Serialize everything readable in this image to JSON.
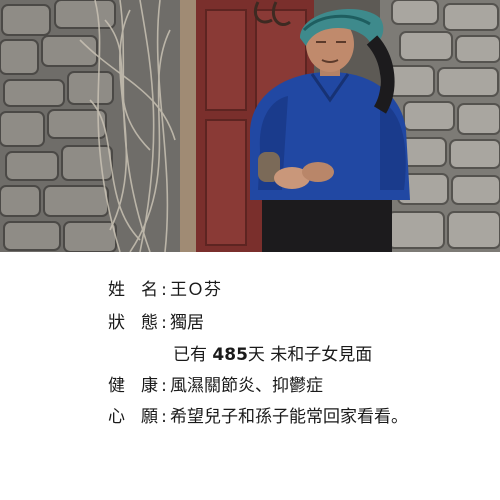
{
  "photo": {
    "subject": "elderly-woman-portrait-icon"
  },
  "profile": {
    "separator": ":",
    "name": {
      "label": "姓 名",
      "value": "王Ｏ芬"
    },
    "status": {
      "label": "狀 態",
      "value": "獨居",
      "note_prefix": "已有 ",
      "note_days": "485",
      "note_suffix": "天 未和子女見面"
    },
    "health": {
      "label": "健 康",
      "value": "風濕關節炎、抑鬱症"
    },
    "wish": {
      "label": "心 願",
      "value": "希望兒子和孫子能常回家看看。"
    }
  },
  "colors": {
    "door": "#7a2f2c",
    "jacket": "#2148a3",
    "stone": "#7d7b76",
    "text": "#1a1a1a"
  }
}
